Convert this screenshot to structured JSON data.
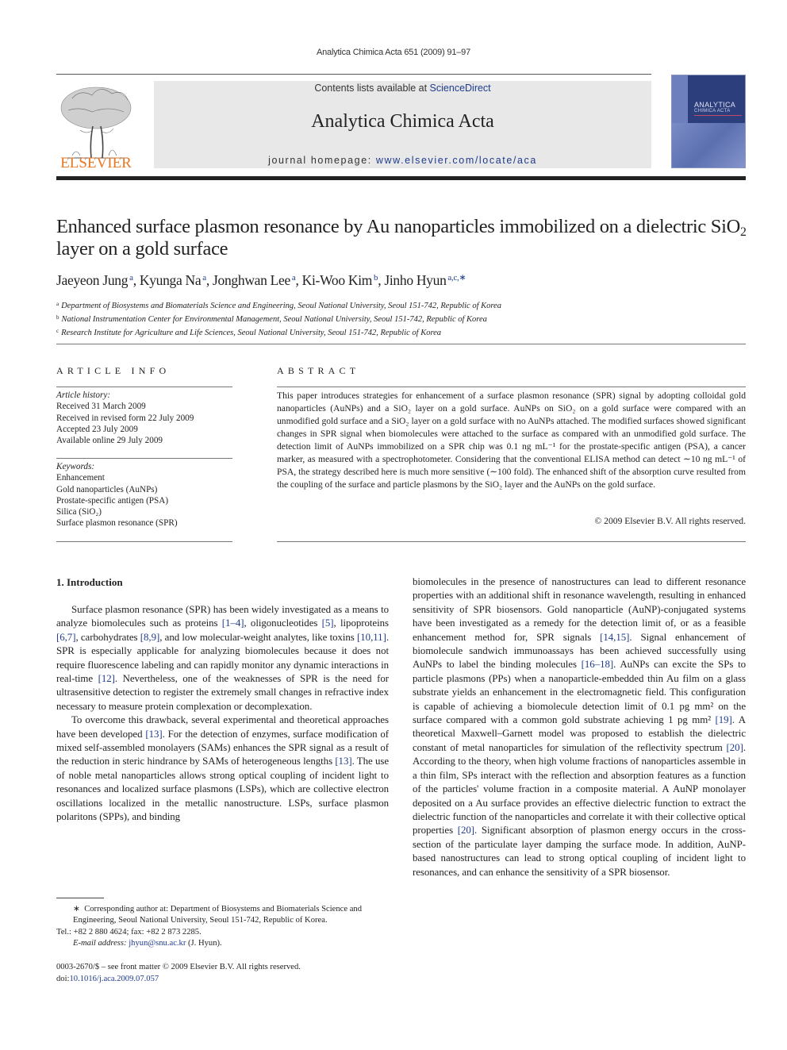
{
  "journal_ref": "Analytica Chimica Acta 651 (2009) 91–97",
  "masthead": {
    "contents_prefix": "Contents lists available at ",
    "contents_link": "ScienceDirect",
    "journal_title": "Analytica Chimica Acta",
    "homepage_prefix": "journal homepage: ",
    "homepage_link": "www.elsevier.com/locate/aca",
    "publisher": "ELSEVIER",
    "cover_title_line1": "ANALYTICA",
    "cover_title_line2": "CHIMICA ACTA",
    "colors": {
      "publisher_orange": "#e87722",
      "link_blue": "#1f3b8c",
      "masthead_gray": "#e8e8e9",
      "cover_blue": "#2d3e7c"
    }
  },
  "article": {
    "title_part1": "Enhanced surface plasmon resonance by Au nanoparticles immobilized on a dielectric SiO",
    "title_sub": "2",
    "title_part2": " layer on a gold surface",
    "authors": [
      {
        "name": "Jaeyeon Jung",
        "aff": "a"
      },
      {
        "name": "Kyunga Na",
        "aff": "a"
      },
      {
        "name": "Jonghwan Lee",
        "aff": "a"
      },
      {
        "name": "Ki-Woo Kim",
        "aff": "b"
      },
      {
        "name": "Jinho Hyun",
        "aff": "a,c,∗"
      }
    ],
    "affiliations": [
      {
        "mark": "a",
        "text": "Department of Biosystems and Biomaterials Science and Engineering, Seoul National University, Seoul 151-742, Republic of Korea"
      },
      {
        "mark": "b",
        "text": "National Instrumentation Center for Environmental Management, Seoul National University, Seoul 151-742, Republic of Korea"
      },
      {
        "mark": "c",
        "text": "Research Institute for Agriculture and Life Sciences, Seoul National University, Seoul 151-742, Republic of Korea"
      }
    ]
  },
  "article_info": {
    "heading": "ARTICLE INFO",
    "history_label": "Article history:",
    "history": [
      "Received 31 March 2009",
      "Received in revised form 22 July 2009",
      "Accepted 23 July 2009",
      "Available online 29 July 2009"
    ],
    "keywords_label": "Keywords:",
    "keywords": [
      "Enhancement",
      "Gold nanoparticles (AuNPs)",
      "Prostate-specific antigen (PSA)",
      "Silica (SiO₂)",
      "Surface plasmon resonance (SPR)"
    ]
  },
  "abstract": {
    "heading": "ABSTRACT",
    "text": "This paper introduces strategies for enhancement of a surface plasmon resonance (SPR) signal by adopting colloidal gold nanoparticles (AuNPs) and a SiO₂ layer on a gold surface. AuNPs on SiO₂ on a gold surface were compared with an unmodified gold surface and a SiO₂ layer on a gold surface with no AuNPs attached. The modified surfaces showed significant changes in SPR signal when biomolecules were attached to the surface as compared with an unmodified gold surface. The detection limit of AuNPs immobilized on a SPR chip was 0.1 ng mL⁻¹ for the prostate-specific antigen (PSA), a cancer marker, as measured with a spectrophotometer. Considering that the conventional ELISA method can detect ∼10 ng mL⁻¹ of PSA, the strategy described here is much more sensitive (∼100 fold). The enhanced shift of the absorption curve resulted from the coupling of the surface and particle plasmons by the SiO₂ layer and the AuNPs on the gold surface.",
    "copyright": "© 2009 Elsevier B.V. All rights reserved."
  },
  "body": {
    "section_heading": "1.  Introduction",
    "left_p1": [
      {
        "t": "Surface plasmon resonance (SPR) has been widely investigated as a means to analyze biomolecules such as proteins "
      },
      {
        "ref": "[1–4]"
      },
      {
        "t": ", oligonucleotides "
      },
      {
        "ref": "[5]"
      },
      {
        "t": ", lipoproteins "
      },
      {
        "ref": "[6,7]"
      },
      {
        "t": ", carbohydrates "
      },
      {
        "ref": "[8,9]"
      },
      {
        "t": ", and low molecular-weight analytes, like toxins "
      },
      {
        "ref": "[10,11]"
      },
      {
        "t": ". SPR is especially applicable for analyzing biomolecules because it does not require fluorescence labeling and can rapidly monitor any dynamic interactions in real-time "
      },
      {
        "ref": "[12]"
      },
      {
        "t": ". Nevertheless, one of the weaknesses of SPR is the need for ultrasensitive detection to register the extremely small changes in refractive index necessary to measure protein complexation or decomplexation."
      }
    ],
    "left_p2": [
      {
        "t": "To overcome this drawback, several experimental and theoretical approaches have been developed "
      },
      {
        "ref": "[13]"
      },
      {
        "t": ". For the detection of enzymes, surface modification of mixed self-assembled monolayers (SAMs) enhances the SPR signal as a result of the reduction in steric hindrance by SAMs of heterogeneous lengths "
      },
      {
        "ref": "[13]"
      },
      {
        "t": ". The use of noble metal nanoparticles allows strong optical coupling of incident light to resonances and localized surface plasmons (LSPs), which are collective electron oscillations localized in the metallic nanostructure. LSPs, surface plasmon polaritons (SPPs), and binding"
      }
    ],
    "right_p1": [
      {
        "t": "biomolecules in the presence of nanostructures can lead to different resonance properties with an additional shift in resonance wavelength, resulting in enhanced sensitivity of SPR biosensors. Gold nanoparticle (AuNP)-conjugated systems have been investigated as a remedy for the detection limit of, or as a feasible enhancement method for, SPR signals "
      },
      {
        "ref": "[14,15]"
      },
      {
        "t": ". Signal enhancement of biomolecule sandwich immunoassays has been achieved successfully using AuNPs to label the binding molecules "
      },
      {
        "ref": "[16–18]"
      },
      {
        "t": ". AuNPs can excite the SPs to particle plasmons (PPs) when a nanoparticle-embedded thin Au film on a glass substrate yields an enhancement in the electromagnetic field. This configuration is capable of achieving a biomolecule detection limit of 0.1 pg mm² on the surface compared with a common gold substrate achieving 1 pg mm² "
      },
      {
        "ref": "[19]"
      },
      {
        "t": ". A theoretical Maxwell–Garnett model was proposed to establish the dielectric constant of metal nanoparticles for simulation of the reflectivity spectrum "
      },
      {
        "ref": "[20]"
      },
      {
        "t": ". According to the theory, when high volume fractions of nanoparticles assemble in a thin film, SPs interact with the reflection and absorption features as a function of the particles' volume fraction in a composite material. A AuNP monolayer deposited on a Au surface provides an effective dielectric function to extract the dielectric function of the nanoparticles and correlate it with their collective optical properties "
      },
      {
        "ref": "[20]"
      },
      {
        "t": ". Significant absorption of plasmon energy occurs in the cross-section of the particulate layer damping the surface mode. In addition, AuNP-based nanostructures can lead to strong optical coupling of incident light to resonances, and can enhance the sensitivity of a SPR biosensor."
      }
    ]
  },
  "footnote": {
    "star": "∗",
    "corresponding": "Corresponding author at: Department of Biosystems and Biomaterials Science and Engineering, Seoul National University, Seoul 151-742, Republic of Korea.",
    "tel": "Tel.: +82 2 880 4624; fax: +82 2 873 2285.",
    "email_label": "E-mail address: ",
    "email": "jhyun@snu.ac.kr",
    "email_suffix": " (J. Hyun)."
  },
  "frontmatter": {
    "issn_line": "0003-2670/$ – see front matter © 2009 Elsevier B.V. All rights reserved.",
    "doi_prefix": "doi:",
    "doi": "10.1016/j.aca.2009.07.057"
  }
}
